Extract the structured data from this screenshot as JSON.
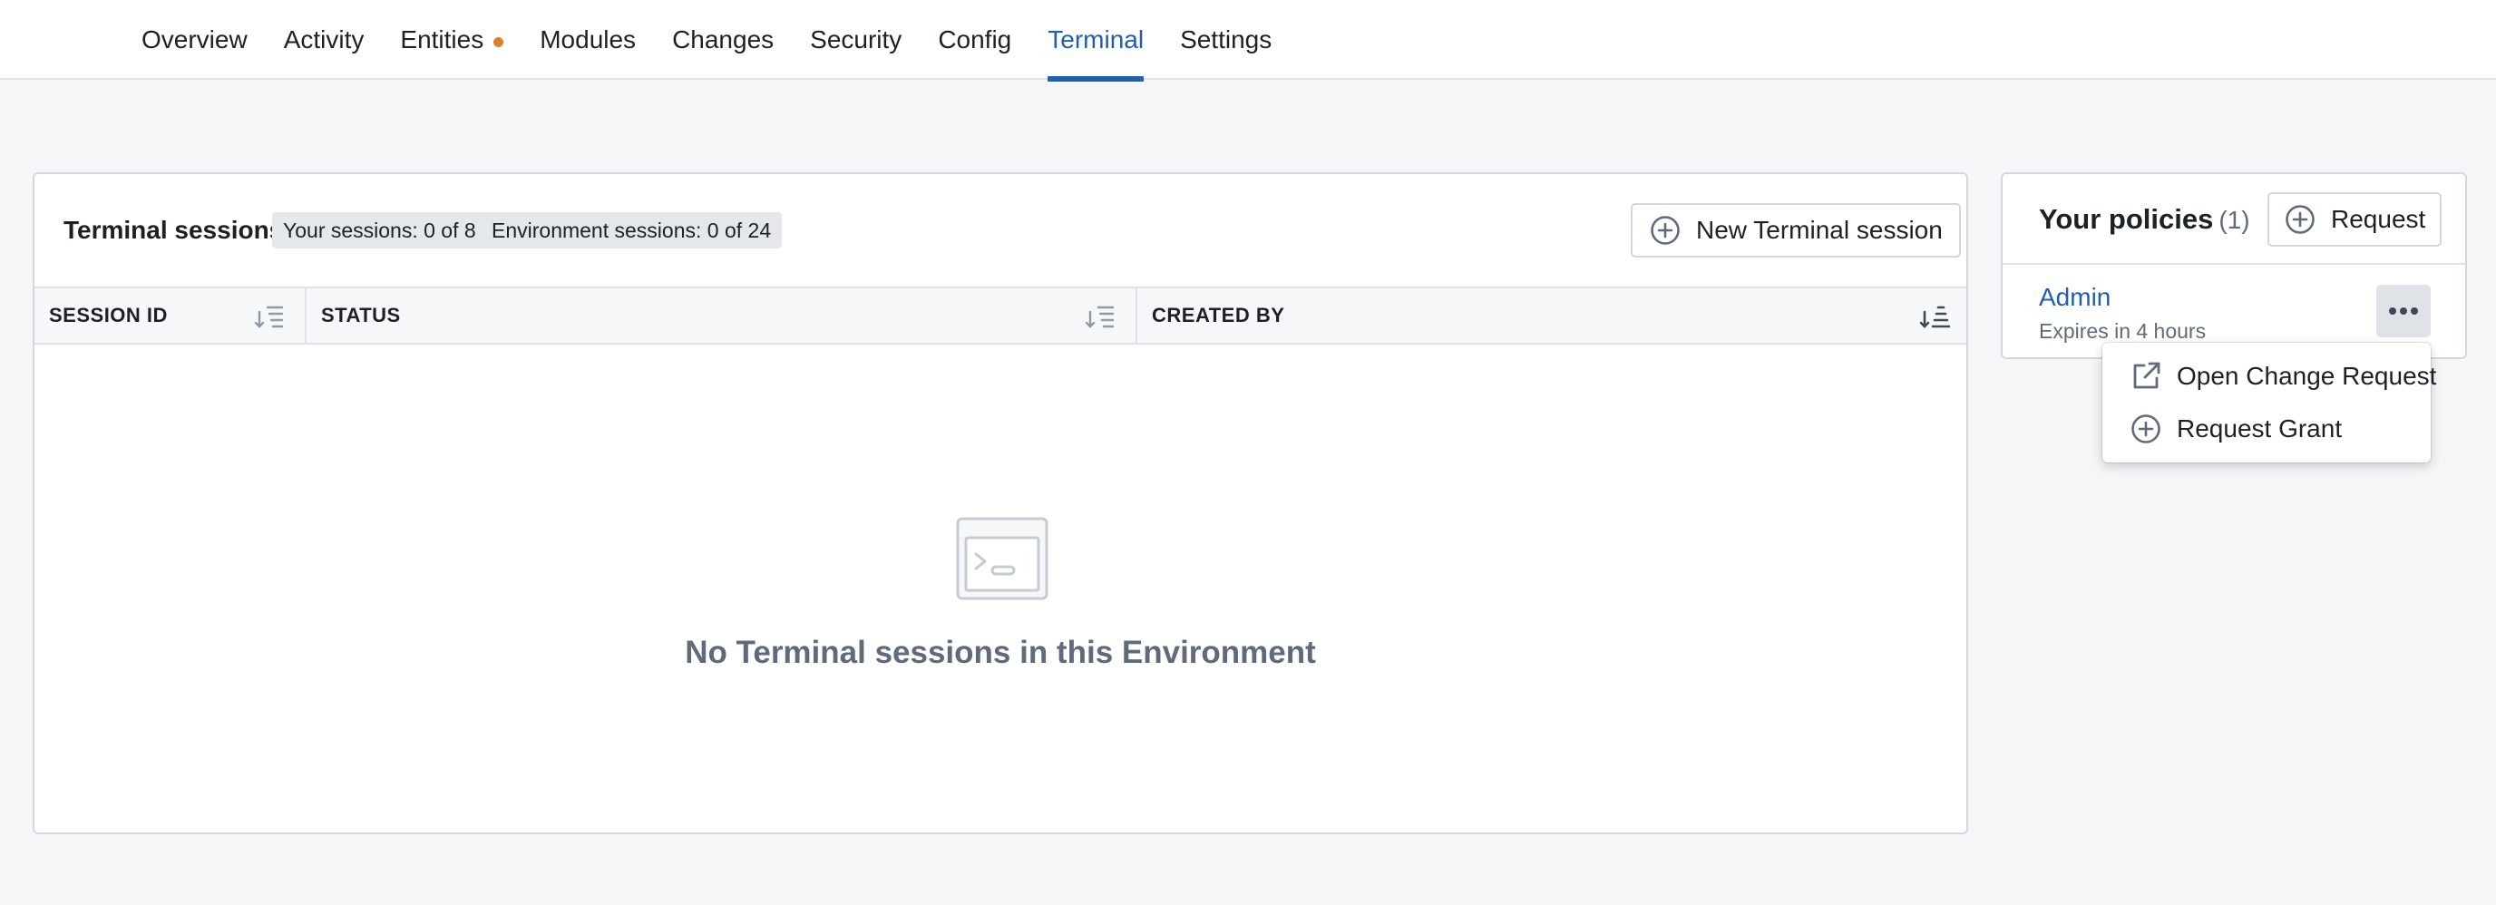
{
  "nav": {
    "tabs": [
      {
        "label": "Overview"
      },
      {
        "label": "Activity"
      },
      {
        "label": "Entities"
      },
      {
        "label": "Modules"
      },
      {
        "label": "Changes"
      },
      {
        "label": "Security"
      },
      {
        "label": "Config"
      },
      {
        "label": "Terminal"
      },
      {
        "label": "Settings"
      }
    ],
    "active_tab": "Terminal",
    "accent_color": "#215db0",
    "entities_dot_color": "#d9822b"
  },
  "sessions": {
    "title": "Terminal sessions",
    "your_sessions_tag": "Your sessions: 0 of 8",
    "environment_sessions_tag": "Environment sessions: 0 of 24",
    "new_session_button": "New Terminal session",
    "columns": [
      "SESSION ID",
      "STATUS",
      "CREATED BY"
    ],
    "empty_message": "No Terminal sessions in this Environment",
    "empty_icon": "terminal-window-icon"
  },
  "policies": {
    "title": "Your policies",
    "count": "(1)",
    "request_button": "Request",
    "items": [
      {
        "name": "Admin",
        "expiry": "Expires in 4 hours"
      }
    ]
  },
  "menu": {
    "items": [
      {
        "label": "Open Change Request",
        "icon": "external-link-icon"
      },
      {
        "label": "Request Grant",
        "icon": "plus-circle-icon"
      }
    ]
  }
}
